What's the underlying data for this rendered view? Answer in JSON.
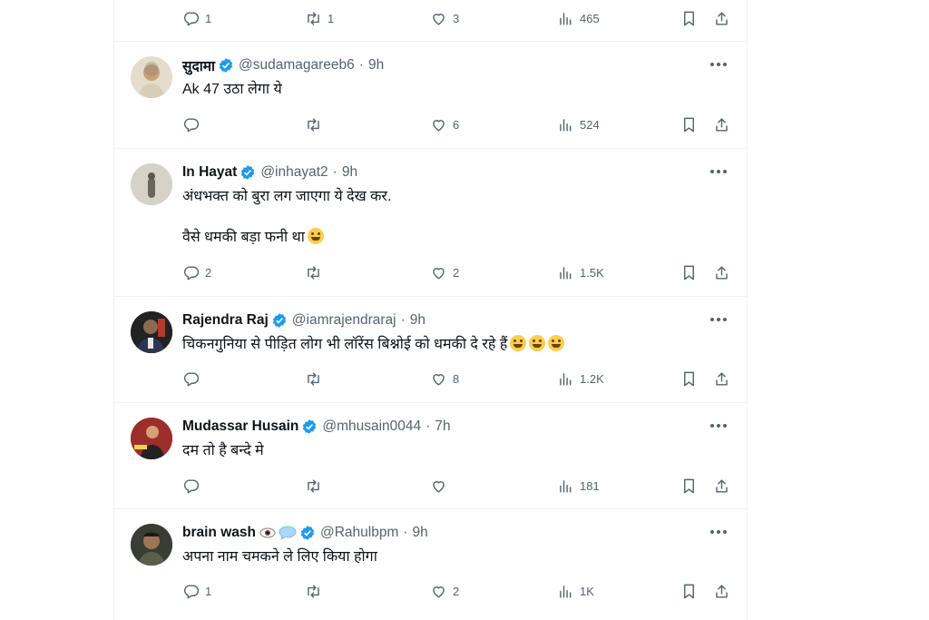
{
  "top_actions": {
    "replies": "1",
    "retweets": "1",
    "likes": "3",
    "views": "465"
  },
  "tweets": [
    {
      "name": "सुदामा",
      "handle": "@sudamagareeb6",
      "time": "9h",
      "lines": [
        "Ak 47 उठा लेगा ये"
      ],
      "replies": "",
      "retweets": "",
      "likes": "6",
      "views": "524",
      "avatar_color": "#c9b79c"
    },
    {
      "name": "In Hayat",
      "handle": "@inhayat2",
      "time": "9h",
      "lines": [
        "अंधभक्त को बुरा लग जाएगा ये देख कर.",
        "वैसे धमकी बड़ा फनी था"
      ],
      "replies": "2",
      "retweets": "",
      "likes": "2",
      "views": "1.5K",
      "avatar_color": "#b7b3a8"
    },
    {
      "name": "Rajendra Raj",
      "handle": "@iamrajendraraj",
      "time": "9h",
      "lines": [
        "चिकनगुनिया से पीड़ित लोग भी लॉरेंस बिश्नोई को धमकी दे रहे हैं"
      ],
      "replies": "",
      "retweets": "",
      "likes": "8",
      "views": "1.2K",
      "avatar_color": "#1d1d1d"
    },
    {
      "name": "Mudassar Husain",
      "handle": "@mhusain0044",
      "time": "7h",
      "lines": [
        "दम तो है बन्दे मे"
      ],
      "replies": "",
      "retweets": "",
      "likes": "",
      "views": "181",
      "avatar_color": "#a8322d"
    },
    {
      "name": "brain wash",
      "handle": "@Rahulbpm",
      "time": "9h",
      "lines": [
        "अपना नाम चमकने ले लिए किया होगा"
      ],
      "replies": "1",
      "retweets": "",
      "likes": "2",
      "views": "1K",
      "avatar_color": "#3b3f34"
    }
  ],
  "colors": {
    "text": "#0f1419",
    "muted": "#536471",
    "verified": "#1d9bf0",
    "divider": "#eff3f4"
  },
  "icons": [
    "reply-icon",
    "retweet-icon",
    "like-icon",
    "views-icon",
    "bookmark-icon",
    "share-icon",
    "verified-icon",
    "more-icon"
  ]
}
